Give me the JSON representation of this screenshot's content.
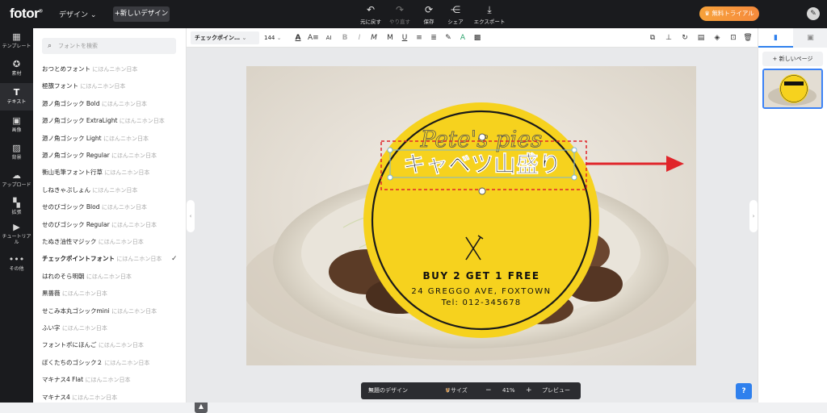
{
  "topbar": {
    "logo": "fotor",
    "design_menu": "デザイン",
    "new_design": "+新しいデザイン",
    "actions": [
      {
        "icon": "undo-icon",
        "label": "元に戻す"
      },
      {
        "icon": "redo-icon",
        "label": "やり直す"
      },
      {
        "icon": "save-icon",
        "label": "保存"
      },
      {
        "icon": "share-icon",
        "label": "シェア"
      },
      {
        "icon": "export-icon",
        "label": "エクスポート"
      }
    ],
    "trial_button": "無料トライアル",
    "accent_color": "#f7a23b"
  },
  "sidebar": {
    "items": [
      {
        "icon": "template-icon",
        "label": "テンプレート"
      },
      {
        "icon": "material-icon",
        "label": "素材"
      },
      {
        "icon": "text-icon",
        "label": "テキスト"
      },
      {
        "icon": "image-icon",
        "label": "画像"
      },
      {
        "icon": "background-icon",
        "label": "背景"
      },
      {
        "icon": "upload-icon",
        "label": "アップロード"
      },
      {
        "icon": "apps-icon",
        "label": "拡張"
      },
      {
        "icon": "tutorial-icon",
        "label": "チュートリアル"
      },
      {
        "icon": "more-icon",
        "label": "その他"
      }
    ],
    "active_index": 2
  },
  "font_panel": {
    "search_placeholder": "フォントを検索",
    "fonts": [
      {
        "name": "おつとめフォント",
        "preview": "にほんニホン日本"
      },
      {
        "name": "極籏フォント",
        "preview": "にほんニホン日本"
      },
      {
        "name": "源ノ角ゴシック Bold",
        "preview": "にほんニホン日本"
      },
      {
        "name": "源ノ角ゴシック ExtraLight",
        "preview": "にほんニホン日本"
      },
      {
        "name": "源ノ角ゴシック Light",
        "preview": "にほんニホン日本"
      },
      {
        "name": "源ノ角ゴシック Regular",
        "preview": "にほんニホン日本"
      },
      {
        "name": "衡山毛筆フォント行草",
        "preview": "にほんニホン日本"
      },
      {
        "name": "しねきゃぷしょん",
        "preview": "にほんニホン日本"
      },
      {
        "name": "せのびゴシック Blod",
        "preview": "にほんニホン日本"
      },
      {
        "name": "せのびゴシック Regular",
        "preview": "にほんニホン日本"
      },
      {
        "name": "たぬき油性マジック",
        "preview": "にほんニホン日本"
      },
      {
        "name": "チェックポイントフォント",
        "preview": "にほんニホン日本",
        "selected": true
      },
      {
        "name": "はれのそら明朝",
        "preview": "にほんニホン日本"
      },
      {
        "name": "黒薔薇",
        "preview": "にほんニホン日本"
      },
      {
        "name": "せこみ本丸ゴシックmini",
        "preview": "にほんニホン日本"
      },
      {
        "name": "ふい字",
        "preview": "にほんニホン日本"
      },
      {
        "name": "フォントポにほんご",
        "preview": "にほんニホン日本"
      },
      {
        "name": "ぼくたちのゴシック２",
        "preview": "にほんニホン日本"
      },
      {
        "name": "マキナス4 Flat",
        "preview": "にほんニホン日本"
      },
      {
        "name": "マキナス4",
        "preview": "にほんニホン日本"
      }
    ]
  },
  "edit_toolbar": {
    "font_name": "チェックポイン…",
    "font_size": "144"
  },
  "canvas": {
    "script_text": "Pete's pies",
    "headline": "キャベツ山盛り",
    "promo": "BUY 2 GET 1 FREE",
    "address": "24 GREGGO AVE, FOXTOWN",
    "phone": "Tel: 012-345678",
    "badge_color": "#f6d21e"
  },
  "right_panel": {
    "add_page": "+ 新しいページ"
  },
  "bottom_bar": {
    "design_name": "無題のデザイン",
    "resize": "リサイズ",
    "minus": "−",
    "zoom": "41%",
    "plus": "+",
    "preview": "プレビュー"
  },
  "help": "?"
}
